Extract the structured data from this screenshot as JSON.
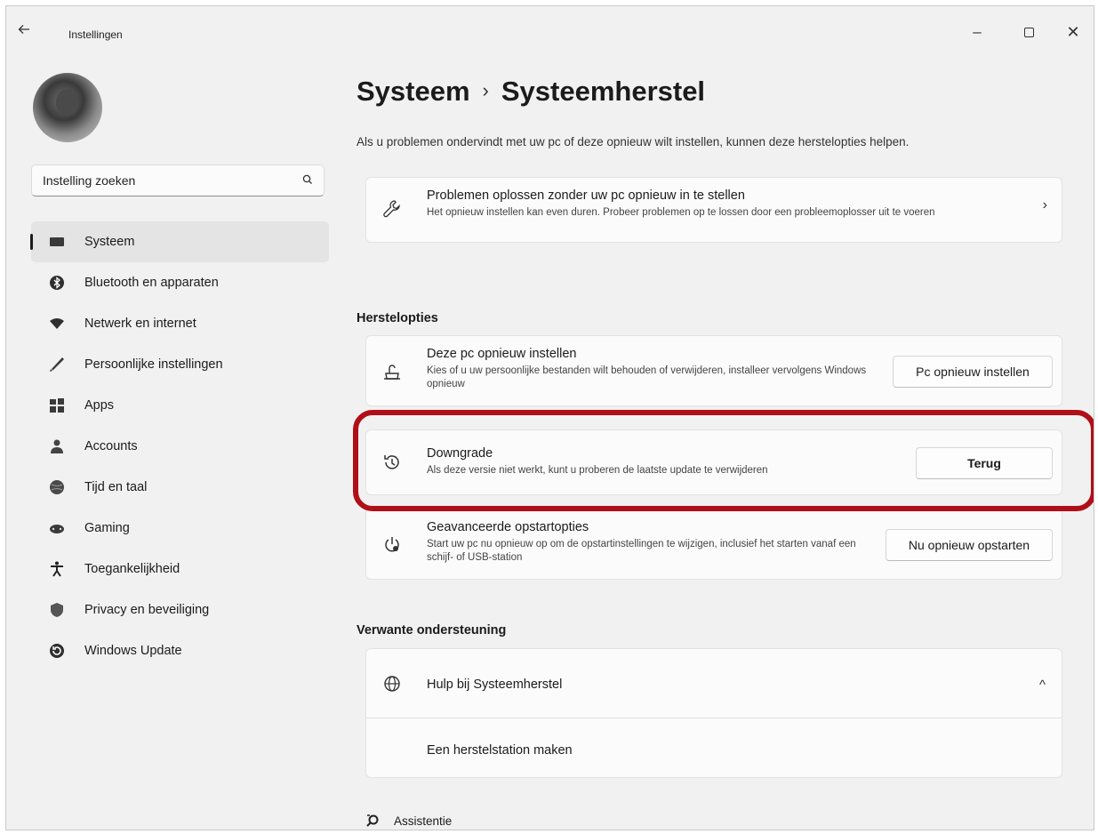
{
  "window": {
    "app_title": "Instellingen",
    "back_icon": "arrow-left-icon",
    "minimize_glyph": "–",
    "close_glyph": "✕"
  },
  "sidebar": {
    "search_placeholder": "Instelling zoeken",
    "items": [
      {
        "label": "Systeem",
        "icon": "monitor-icon",
        "active": true
      },
      {
        "label": "Bluetooth en apparaten",
        "icon": "bluetooth-icon"
      },
      {
        "label": "Netwerk en internet",
        "icon": "wifi-icon"
      },
      {
        "label": "Persoonlijke instellingen",
        "icon": "brush-icon"
      },
      {
        "label": "Apps",
        "icon": "apps-icon"
      },
      {
        "label": "Accounts",
        "icon": "person-icon"
      },
      {
        "label": "Tijd en taal",
        "icon": "globe-clock-icon"
      },
      {
        "label": "Gaming",
        "icon": "gamepad-icon"
      },
      {
        "label": "Toegankelijkheid",
        "icon": "accessibility-icon"
      },
      {
        "label": "Privacy en beveiliging",
        "icon": "shield-icon"
      },
      {
        "label": "Windows Update",
        "icon": "update-icon"
      }
    ]
  },
  "main": {
    "breadcrumb_parent": "Systeem",
    "breadcrumb_sep": "›",
    "breadcrumb_current": "Systeemherstel",
    "description": "Als u problemen ondervindt met uw pc of deze opnieuw wilt instellen, kunnen deze herstelopties helpen.",
    "troubleshoot_card": {
      "title": "Problemen oplossen zonder uw pc opnieuw in te stellen",
      "desc": "Het opnieuw instellen kan even duren. Probeer problemen op te lossen door een probleemoplosser uit te voeren",
      "chevron": "›"
    },
    "recovery_heading": "Herstelopties",
    "reset_card": {
      "title": "Deze pc opnieuw instellen",
      "desc": "Kies of u uw persoonlijke bestanden wilt behouden of verwijderen, installeer vervolgens Windows opnieuw",
      "button": "Pc opnieuw instellen"
    },
    "downgrade_card": {
      "title": "Downgrade",
      "desc": "Als deze versie niet werkt, kunt u proberen de laatste update te verwijderen",
      "button": "Terug"
    },
    "startup_card": {
      "title": "Geavanceerde opstartopties",
      "desc": "Start uw pc nu opnieuw op om de opstartinstellingen te wijzigen, inclusief het starten vanaf een schijf- of USB-station",
      "button": "Nu opnieuw opstarten"
    },
    "related_heading": "Verwante ondersteuning",
    "help": {
      "title": "Hulp bij Systeemherstel",
      "chevron": "^",
      "link": "Een herstelstation maken"
    },
    "assist_label": "Assistentie"
  },
  "colors": {
    "highlight": "#b00f17",
    "background": "#f1f1f1",
    "card": "#fbfbfb"
  }
}
